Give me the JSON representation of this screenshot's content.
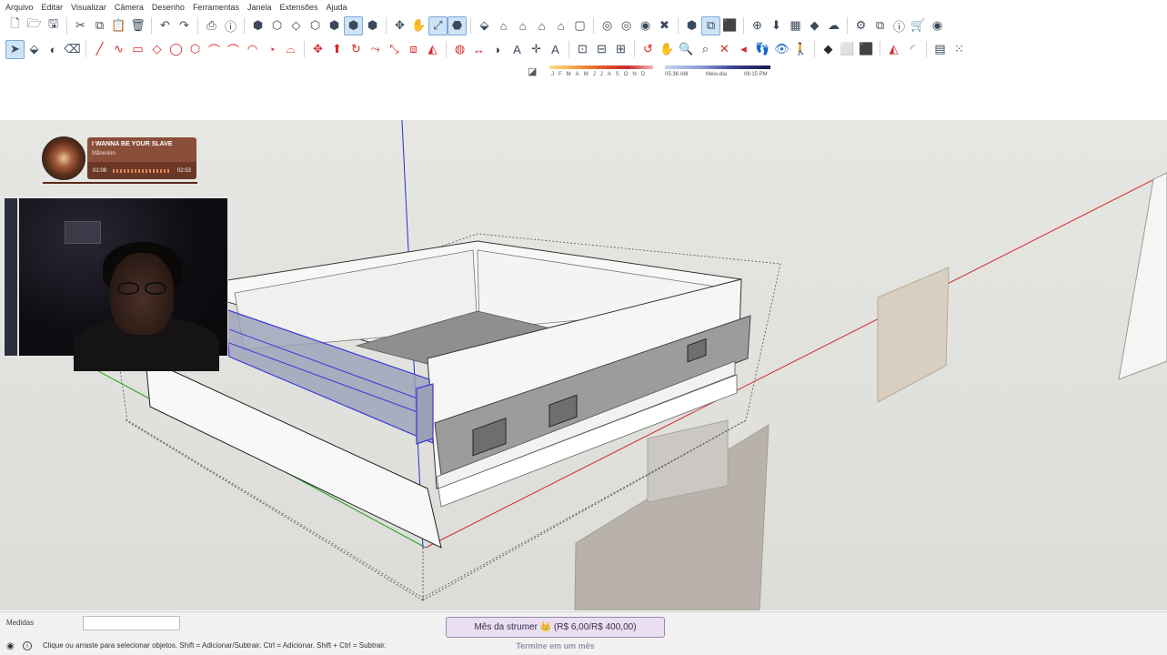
{
  "menu": [
    "Arquivo",
    "Editar",
    "Visualizar",
    "Câmera",
    "Desenho",
    "Ferramentas",
    "Janela",
    "Extensões",
    "Ajuda"
  ],
  "toolbar1": [
    {
      "icon": "new-file-icon",
      "glyph": "🗋"
    },
    {
      "icon": "open-folder-icon",
      "glyph": "🗁"
    },
    {
      "icon": "save-icon",
      "glyph": "🖫"
    },
    {
      "sep": true
    },
    {
      "icon": "cut-icon",
      "glyph": "✂"
    },
    {
      "icon": "copy-icon",
      "glyph": "⧉"
    },
    {
      "icon": "paste-icon",
      "glyph": "📋"
    },
    {
      "icon": "delete-icon",
      "glyph": "🗑"
    },
    {
      "sep": true
    },
    {
      "icon": "undo-icon",
      "glyph": "↶"
    },
    {
      "icon": "redo-icon",
      "glyph": "↷"
    },
    {
      "sep": true
    },
    {
      "icon": "print-icon",
      "glyph": "⎙"
    },
    {
      "icon": "model-info-icon",
      "glyph": "ⓘ"
    },
    {
      "sep": true
    },
    {
      "icon": "xray-view-icon",
      "glyph": "⬢"
    },
    {
      "icon": "back-edges-icon",
      "glyph": "⬡"
    },
    {
      "icon": "wireframe-icon",
      "glyph": "◇"
    },
    {
      "icon": "hidden-line-icon",
      "glyph": "⬡"
    },
    {
      "icon": "shaded-icon",
      "glyph": "⬢"
    },
    {
      "icon": "shaded-textures-icon",
      "glyph": "⬢",
      "selected": true
    },
    {
      "icon": "monochrome-icon",
      "glyph": "⬢"
    },
    {
      "sep": true
    },
    {
      "icon": "orbit-icon",
      "glyph": "✥"
    },
    {
      "icon": "pan-icon",
      "glyph": "✋"
    },
    {
      "icon": "zoom-extents-icon",
      "glyph": "⤢",
      "selected": true
    },
    {
      "icon": "component-icon",
      "glyph": "⬣",
      "selected": true
    },
    {
      "sep": true
    },
    {
      "icon": "iso-view-icon",
      "glyph": "⬙"
    },
    {
      "icon": "top-view-icon",
      "glyph": "⌂"
    },
    {
      "icon": "front-view-icon",
      "glyph": "⌂"
    },
    {
      "icon": "right-view-icon",
      "glyph": "⌂"
    },
    {
      "icon": "back-view-icon",
      "glyph": "⌂"
    },
    {
      "icon": "left-view-icon",
      "glyph": "▢"
    },
    {
      "sep": true
    },
    {
      "icon": "solid-union-icon",
      "glyph": "◎"
    },
    {
      "icon": "solid-intersect-icon",
      "glyph": "◎"
    },
    {
      "icon": "solid-subtract-icon",
      "glyph": "◉"
    },
    {
      "icon": "solid-trim-icon",
      "glyph": "✖"
    },
    {
      "sep": true
    },
    {
      "icon": "extension-warehouse-icon",
      "glyph": "⬢"
    },
    {
      "icon": "layout-icon",
      "glyph": "⧉",
      "selected": true
    },
    {
      "icon": "style-builder-icon",
      "glyph": "⬛"
    },
    {
      "sep": true
    },
    {
      "icon": "add-location-icon",
      "glyph": "⊕"
    },
    {
      "icon": "import-icon",
      "glyph": "⬇"
    },
    {
      "icon": "checker-icon",
      "glyph": "▦"
    },
    {
      "icon": "ruby-icon",
      "glyph": "◆"
    },
    {
      "icon": "cloud-icon",
      "glyph": "☁"
    },
    {
      "sep": true
    },
    {
      "icon": "settings-icon",
      "glyph": "⚙"
    },
    {
      "icon": "window-icon",
      "glyph": "⧉"
    },
    {
      "icon": "info-icon",
      "glyph": "ⓘ"
    },
    {
      "icon": "cart-icon",
      "glyph": "🛒"
    },
    {
      "icon": "account-icon",
      "glyph": "◉"
    }
  ],
  "toolbar2": [
    {
      "icon": "select-arrow-icon",
      "glyph": "➤",
      "selected": true
    },
    {
      "icon": "make-component-icon",
      "glyph": "⬙"
    },
    {
      "icon": "paint-bucket-icon",
      "glyph": "◐"
    },
    {
      "icon": "eraser-icon",
      "glyph": "⌫"
    },
    {
      "sep": true
    },
    {
      "icon": "line-icon",
      "glyph": "╱",
      "color": "red"
    },
    {
      "icon": "freehand-icon",
      "glyph": "∿",
      "color": "red"
    },
    {
      "icon": "rectangle-icon",
      "glyph": "▭",
      "color": "red"
    },
    {
      "icon": "rotated-rect-icon",
      "glyph": "◇",
      "color": "red"
    },
    {
      "icon": "circle-icon",
      "glyph": "◯",
      "color": "red"
    },
    {
      "icon": "polygon-icon",
      "glyph": "⬡",
      "color": "red"
    },
    {
      "icon": "arc-icon",
      "glyph": "⌒",
      "color": "red"
    },
    {
      "icon": "arc-2-icon",
      "glyph": "⌒",
      "color": "red"
    },
    {
      "icon": "arc-3-icon",
      "glyph": "◠",
      "color": "red"
    },
    {
      "icon": "pie-icon",
      "glyph": "◔",
      "color": "red"
    },
    {
      "icon": "arc-4-icon",
      "glyph": "⌓",
      "color": "red"
    },
    {
      "sep": true
    },
    {
      "icon": "move-icon",
      "glyph": "✥",
      "color": "red"
    },
    {
      "icon": "push-pull-icon",
      "glyph": "⬆",
      "color": "red"
    },
    {
      "icon": "rotate-icon",
      "glyph": "↻",
      "color": "red"
    },
    {
      "icon": "follow-me-icon",
      "glyph": "⤳",
      "color": "red"
    },
    {
      "icon": "scale-icon",
      "glyph": "⤡",
      "color": "red"
    },
    {
      "icon": "offset-icon",
      "glyph": "⧈",
      "color": "red"
    },
    {
      "icon": "flip-icon",
      "glyph": "◭",
      "color": "red"
    },
    {
      "sep": true
    },
    {
      "icon": "tape-measure-icon",
      "glyph": "◍",
      "color": "red"
    },
    {
      "icon": "dimension-icon",
      "glyph": "↔",
      "color": "red"
    },
    {
      "icon": "protractor-icon",
      "glyph": "◗"
    },
    {
      "icon": "text-icon",
      "glyph": "A"
    },
    {
      "icon": "axes-icon",
      "glyph": "✛"
    },
    {
      "icon": "3d-text-icon",
      "glyph": "A"
    },
    {
      "sep": true
    },
    {
      "icon": "position-camera-icon",
      "glyph": "⊡"
    },
    {
      "icon": "section-plane-icon",
      "glyph": "⊟"
    },
    {
      "icon": "display-section-icon",
      "glyph": "⊞"
    },
    {
      "sep": true
    },
    {
      "icon": "orbit-tool-icon",
      "glyph": "↺",
      "color": "red"
    },
    {
      "icon": "pan-tool-icon",
      "glyph": "✋",
      "color": "red"
    },
    {
      "icon": "zoom-icon",
      "glyph": "🔍"
    },
    {
      "icon": "zoom-window-icon",
      "glyph": "⌕"
    },
    {
      "icon": "zoom-extents-2-icon",
      "glyph": "✕",
      "color": "red"
    },
    {
      "icon": "previous-icon",
      "glyph": "◂",
      "color": "red"
    },
    {
      "icon": "walk-icon",
      "glyph": "👣",
      "color": "red"
    },
    {
      "icon": "look-around-icon",
      "glyph": "👁",
      "color": "blue"
    },
    {
      "icon": "person-icon",
      "glyph": "🚶"
    },
    {
      "sep": true
    },
    {
      "icon": "sandbox-icon",
      "glyph": "◆",
      "color": "dark"
    },
    {
      "icon": "box-icon",
      "glyph": "⬜",
      "color": "grey"
    },
    {
      "icon": "textured-box-icon",
      "glyph": "⬛",
      "color": "grey"
    },
    {
      "sep": true
    },
    {
      "icon": "mirror-icon",
      "glyph": "◭",
      "color": "red"
    },
    {
      "icon": "curve-icon",
      "glyph": "◜",
      "color": "grey"
    },
    {
      "sep": true
    },
    {
      "icon": "panel-icon",
      "glyph": "▤"
    },
    {
      "icon": "grid-icon",
      "glyph": "⁙"
    }
  ],
  "shadows": {
    "months": [
      "J",
      "F",
      "M",
      "A",
      "M",
      "J",
      "J",
      "A",
      "S",
      "O",
      "N",
      "D"
    ],
    "sunrise": "05:36 AM",
    "midday": "Meio-dia",
    "sunset": "06:15 PM"
  },
  "music": {
    "song": "I WANNA BE YOUR SLAVE",
    "artist": "Måneskin",
    "elapsed": "01:08",
    "total": "02:53",
    "progress": 1.0
  },
  "status": {
    "measure_label": "Medidas",
    "measure_value": "",
    "hint": "Clique ou arraste para selecionar objetos. Shift = Adicionar/Subtrair. Ctrl = Adicionar. Shift + Ctrl = Subtrair."
  },
  "goal": {
    "title": "Mês da strumer 👑 (R$ 6,00/R$ 400,00)",
    "subtitle": "Termine em um mês"
  },
  "colors": {
    "accent": "#2a6ebd",
    "axis_red": "#d62828",
    "axis_blue": "#2233cc",
    "axis_green": "#2aa02a",
    "selection_blue": "#3a3ad8"
  }
}
